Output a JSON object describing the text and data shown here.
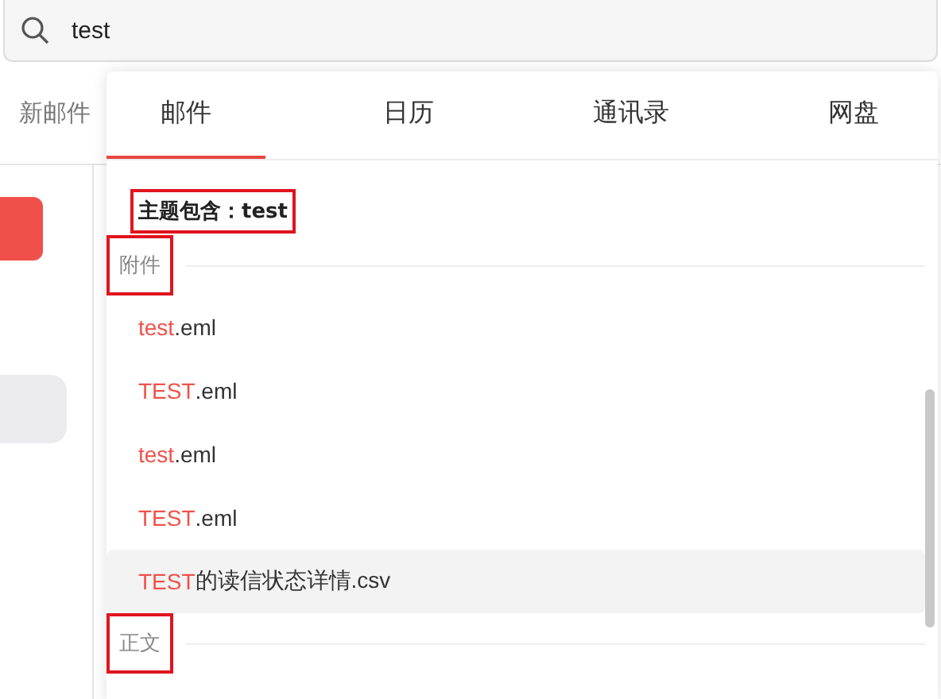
{
  "search": {
    "value": "test"
  },
  "background": {
    "tab_label": "新邮件"
  },
  "popup": {
    "tabs": [
      {
        "label": "邮件",
        "selected": true
      },
      {
        "label": "日历",
        "selected": false
      },
      {
        "label": "通讯录",
        "selected": false
      },
      {
        "label": "网盘",
        "selected": false
      }
    ],
    "subject": {
      "label": "主题包含：test",
      "annotated": true
    },
    "sections": [
      {
        "title": "附件",
        "annotated": true,
        "items": [
          {
            "match": "test",
            "rest": ".eml",
            "selected": false
          },
          {
            "match": "TEST",
            "rest": ".eml",
            "selected": false
          },
          {
            "match": "test",
            "rest": ".eml",
            "selected": false
          },
          {
            "match": "TEST",
            "rest": ".eml",
            "selected": false
          },
          {
            "match": "TEST",
            "rest": "的读信状态详情.csv",
            "selected": true
          }
        ]
      },
      {
        "title": "正文",
        "annotated": true
      }
    ]
  }
}
